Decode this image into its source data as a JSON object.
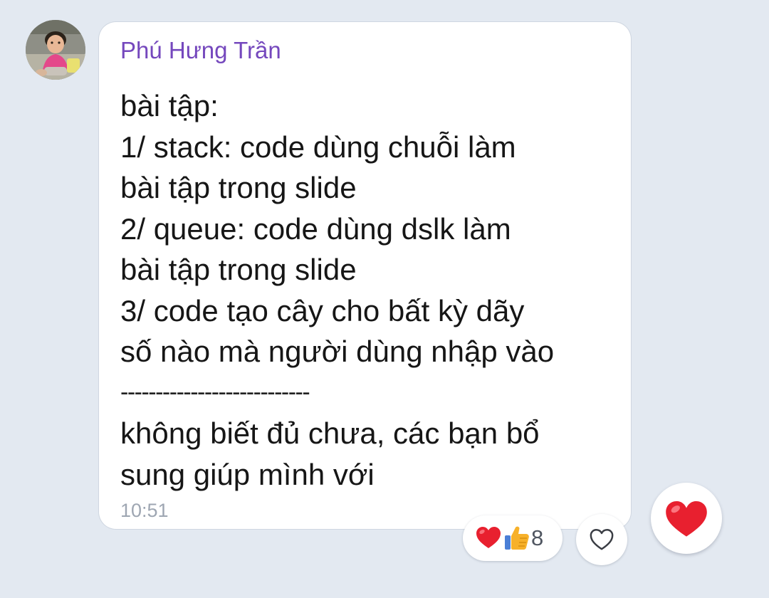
{
  "message": {
    "sender_name": "Phú Hưng Trần",
    "lines": [
      "bài tập:",
      "1/ stack: code dùng chuỗi làm",
      "bài tập trong slide",
      "2/ queue: code dùng dslk làm",
      "bài tập trong slide",
      "3/ code tạo cây cho bất kỳ dãy",
      "số nào mà người dùng nhập vào",
      "---------------------------",
      "không biết đủ chưa, các bạn bổ",
      "sung giúp mình với"
    ],
    "time": "10:51"
  },
  "reactions": {
    "icons": [
      "heart-icon",
      "thumbs-up-icon"
    ],
    "count": "8"
  },
  "actions": {
    "reaction_outline_icon": "heart-outline-icon",
    "quick_reaction_icon": "heart-icon"
  },
  "colors": {
    "background": "#e3e9f1",
    "sender_name": "#7548bd",
    "heart": "#e8202f",
    "thumb": "#f7b12a",
    "time": "#9ea6b2"
  }
}
